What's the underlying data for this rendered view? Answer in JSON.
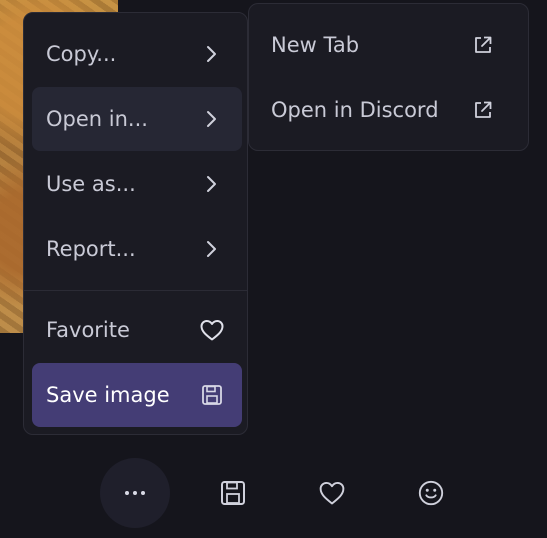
{
  "colors": {
    "background": "#15151c",
    "menu_background": "#1b1b23",
    "active_item": "#262734",
    "primary_accent": "#443d75",
    "text": "#c9cad6"
  },
  "context_menu": {
    "items": [
      {
        "label": "Copy...",
        "icon": "chevron-right-icon"
      },
      {
        "label": "Open in...",
        "icon": "chevron-right-icon",
        "highlighted": true
      },
      {
        "label": "Use as...",
        "icon": "chevron-right-icon"
      },
      {
        "label": "Report...",
        "icon": "chevron-right-icon"
      },
      {
        "label": "Favorite",
        "icon": "heart-icon"
      },
      {
        "label": "Save image",
        "icon": "floppy-disk-icon",
        "primary": true
      }
    ]
  },
  "submenu": {
    "items": [
      {
        "label": "New Tab",
        "icon": "external-link-icon"
      },
      {
        "label": "Open in Discord",
        "icon": "external-link-icon"
      }
    ]
  },
  "bottom_toolbar": {
    "buttons": [
      {
        "icon": "more-dots-icon",
        "active": true
      },
      {
        "icon": "floppy-disk-icon"
      },
      {
        "icon": "heart-icon"
      },
      {
        "icon": "smiley-icon"
      }
    ]
  }
}
